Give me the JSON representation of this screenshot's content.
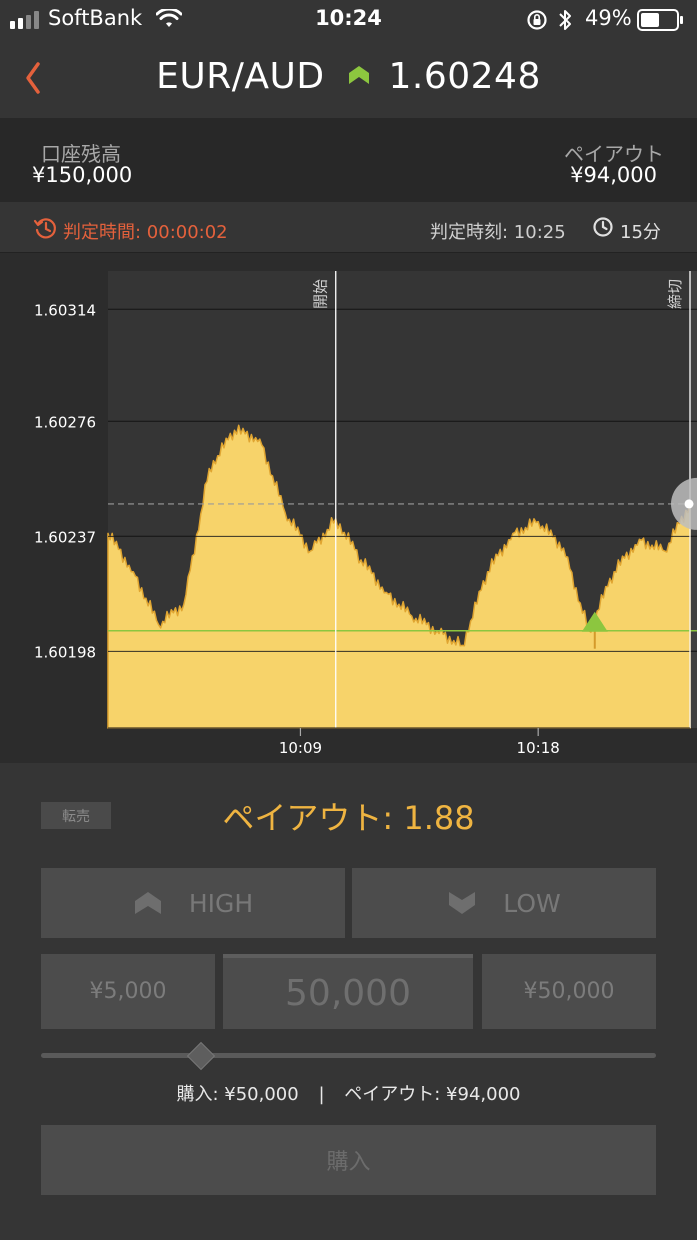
{
  "status_bar": {
    "carrier": "SoftBank",
    "time": "10:24",
    "battery": "49%",
    "icons": [
      "signal-icon",
      "wifi-icon",
      "rotation-lock-icon",
      "bluetooth-icon",
      "battery-icon"
    ]
  },
  "nav": {
    "pair": "EUR/AUD",
    "rate": "1.60248",
    "rate_direction": "up",
    "accent_color": "#e4613c",
    "up_color": "#8cc63f"
  },
  "account": {
    "balance_label": "口座残高",
    "balance_value": "¥150,000",
    "payout_label": "ペイアウト",
    "payout_value": "¥94,000"
  },
  "timer": {
    "countdown_label": "判定時間: 00:00:02",
    "judge_time_label": "判定時刻: 10:25",
    "duration": "15分"
  },
  "chart_data": {
    "type": "area",
    "series": [
      {
        "x": [
          "10:01",
          "10:02",
          "10:03",
          "10:04",
          "10:05",
          "10:06",
          "10:07",
          "10:08",
          "10:09",
          "10:10",
          "10:11",
          "10:12",
          "10:13",
          "10:14",
          "10:15",
          "10:16",
          "10:17",
          "10:18",
          "10:19",
          "10:20",
          "10:21",
          "10:22",
          "10:23",
          "10:24"
        ],
        "values": [
          1.60238,
          1.60225,
          1.60207,
          1.60214,
          1.6026,
          1.60273,
          1.6027,
          1.60245,
          1.60232,
          1.60243,
          1.60229,
          1.60218,
          1.6021,
          1.60205,
          1.602,
          1.60225,
          1.60238,
          1.60242,
          1.60233,
          1.60205,
          1.60225,
          1.60236,
          1.60232,
          1.60248
        ]
      }
    ],
    "y_ticks": [
      "1.60314",
      "1.60276",
      "1.60237",
      "1.60198"
    ],
    "ylim": [
      1.60172,
      1.60327
    ],
    "x_ticks": [
      "10:09",
      "10:18"
    ],
    "grid": true,
    "markers": [
      {
        "label": "開始",
        "x": "10:10"
      },
      {
        "label": "締切",
        "x": "10:24"
      }
    ],
    "entry_level": 1.60205,
    "current_level": 1.60248,
    "fill_color": "#f7d36a",
    "line_color": "#e0a531"
  },
  "trade": {
    "resale_label": "転売",
    "payout_rate_label": "ペイアウト: 1.88",
    "high_label": "HIGH",
    "low_label": "LOW",
    "amount_left": "¥5,000",
    "amount_center": "50,000",
    "amount_right": "¥50,000",
    "slider_level": 0.26,
    "summary_purchase": "購入: ¥50,000",
    "summary_separator": "|",
    "summary_payout": "ペイアウト: ¥94,000",
    "buy_label": "購入",
    "payout_color": "#efb441"
  }
}
